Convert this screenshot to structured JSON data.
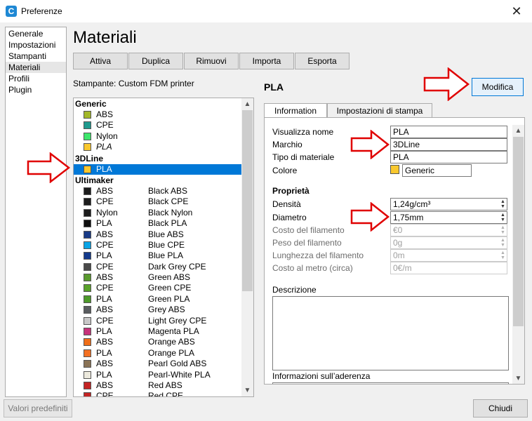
{
  "window": {
    "title": "Preferenze",
    "app_icon_glyph": "C",
    "close_glyph": "✕"
  },
  "nav": {
    "items": [
      "Generale",
      "Impostazioni",
      "Stampanti",
      "Materiali",
      "Profili",
      "Plugin"
    ],
    "active": "Materiali"
  },
  "page": {
    "title": "Materiali",
    "actions": [
      "Attiva",
      "Duplica",
      "Rimuovi",
      "Importa",
      "Esporta"
    ],
    "printer_label": "Stampante: Custom FDM printer"
  },
  "materials": {
    "groups": [
      {
        "name": "Generic",
        "items": [
          {
            "type": "ABS",
            "name": "",
            "color": "#a3b829"
          },
          {
            "type": "CPE",
            "name": "",
            "color": "#1f9a8e"
          },
          {
            "type": "Nylon",
            "name": "",
            "color": "#3de66b"
          },
          {
            "type": "PLA",
            "name": "",
            "color": "#f9c82e",
            "italic": true
          }
        ]
      },
      {
        "name": "3DLine",
        "items": [
          {
            "type": "PLA",
            "name": "",
            "color": "#f9c82e",
            "selected": true
          }
        ]
      },
      {
        "name": "Ultimaker",
        "items": [
          {
            "type": "ABS",
            "name": "Black ABS",
            "color": "#1c1c1c"
          },
          {
            "type": "CPE",
            "name": "Black CPE",
            "color": "#1c1c1c"
          },
          {
            "type": "Nylon",
            "name": "Black Nylon",
            "color": "#1c1c1c"
          },
          {
            "type": "PLA",
            "name": "Black PLA",
            "color": "#0f0f0f"
          },
          {
            "type": "ABS",
            "name": "Blue ABS",
            "color": "#183a86"
          },
          {
            "type": "CPE",
            "name": "Blue CPE",
            "color": "#0aa4e6"
          },
          {
            "type": "PLA",
            "name": "Blue PLA",
            "color": "#133a8c"
          },
          {
            "type": "CPE",
            "name": "Dark Grey CPE",
            "color": "#4a4a4a"
          },
          {
            "type": "ABS",
            "name": "Green ABS",
            "color": "#5a9a2e"
          },
          {
            "type": "CPE",
            "name": "Green CPE",
            "color": "#5aa22a"
          },
          {
            "type": "PLA",
            "name": "Green PLA",
            "color": "#4d9a2a"
          },
          {
            "type": "ABS",
            "name": "Grey ABS",
            "color": "#5a5d60"
          },
          {
            "type": "CPE",
            "name": "Light Grey CPE",
            "color": "#c8c8c8"
          },
          {
            "type": "PLA",
            "name": "Magenta PLA",
            "color": "#c7327a"
          },
          {
            "type": "ABS",
            "name": "Orange ABS",
            "color": "#ef6e18"
          },
          {
            "type": "PLA",
            "name": "Orange PLA",
            "color": "#f37022"
          },
          {
            "type": "ABS",
            "name": "Pearl Gold ABS",
            "color": "#8a7356"
          },
          {
            "type": "PLA",
            "name": "Pearl-White PLA",
            "color": "#ece9dd"
          },
          {
            "type": "ABS",
            "name": "Red ABS",
            "color": "#c42424"
          },
          {
            "type": "CPE",
            "name": "Red CPE",
            "color": "#c42424"
          }
        ]
      }
    ]
  },
  "detail": {
    "title": "PLA",
    "edit_button": "Modifica",
    "tabs": [
      "Information",
      "Impostazioni di stampa"
    ],
    "active_tab": "Information",
    "fields": {
      "display_name": {
        "label": "Visualizza nome",
        "value": "PLA"
      },
      "brand": {
        "label": "Marchio",
        "value": "3DLine"
      },
      "material_type": {
        "label": "Tipo di materiale",
        "value": "PLA"
      },
      "color": {
        "label": "Colore",
        "value": "Generic",
        "swatch": "#f9c82e"
      }
    },
    "properties_header": "Proprietà",
    "properties": {
      "density": {
        "label": "Densità",
        "value": "1,24g/cm³"
      },
      "diameter": {
        "label": "Diametro",
        "value": "1,75mm"
      },
      "filament_cost": {
        "label": "Costo del filamento",
        "value": "€0"
      },
      "filament_weight": {
        "label": "Peso del filamento",
        "value": "0g"
      },
      "filament_length": {
        "label": "Lunghezza del filamento",
        "value": "0m"
      },
      "cost_per_meter": {
        "label": "Costo al metro (circa)",
        "value": "0€/m"
      }
    },
    "description_label": "Descrizione",
    "adhesion_label": "Informazioni sull’aderenza"
  },
  "footer": {
    "reset_button": "Valori predefiniti",
    "close_button": "Chiudi"
  },
  "colors": {
    "selection": "#0078d7",
    "annotation_arrow": "#e00000",
    "edit_button_bg": "#e5f1fb"
  }
}
